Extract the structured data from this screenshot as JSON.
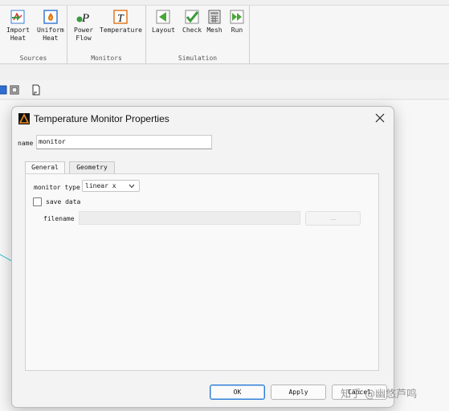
{
  "ribbon": {
    "groups": [
      {
        "label": "Sources",
        "buttons": [
          {
            "label": "Import\nHeat",
            "icon": "import-heat-icon"
          },
          {
            "label": "Uniform\nHeat",
            "icon": "uniform-heat-icon"
          }
        ]
      },
      {
        "label": "Monitors",
        "buttons": [
          {
            "label": "Power\nFlow",
            "icon": "power-flow-icon"
          },
          {
            "label": "Temperature",
            "icon": "temperature-icon"
          }
        ]
      },
      {
        "label": "Simulation",
        "buttons": [
          {
            "label": "Layout",
            "icon": "layout-icon"
          },
          {
            "label": "Check",
            "icon": "check-icon"
          },
          {
            "label": "Mesh",
            "icon": "mesh-icon"
          },
          {
            "label": "Run",
            "icon": "run-icon"
          }
        ]
      }
    ]
  },
  "dialog": {
    "title": "Temperature Monitor Properties",
    "name_label": "name",
    "name_value": "monitor",
    "tabs": [
      "General",
      "Geometry"
    ],
    "active_tab": "General",
    "monitor_type_label": "monitor type",
    "monitor_type_value": "linear x",
    "save_data_label": "save data",
    "save_data_checked": false,
    "filename_label": "filename",
    "filename_value": "",
    "browse_label": "...",
    "buttons": {
      "ok": "OK",
      "apply": "Apply",
      "cancel": "Cancel"
    }
  },
  "colors": {
    "accent": "#2d7bd6",
    "icon_green": "#3a9a3a",
    "icon_orange": "#e07820"
  },
  "watermark": "知乎 @幽悠芦鸣"
}
